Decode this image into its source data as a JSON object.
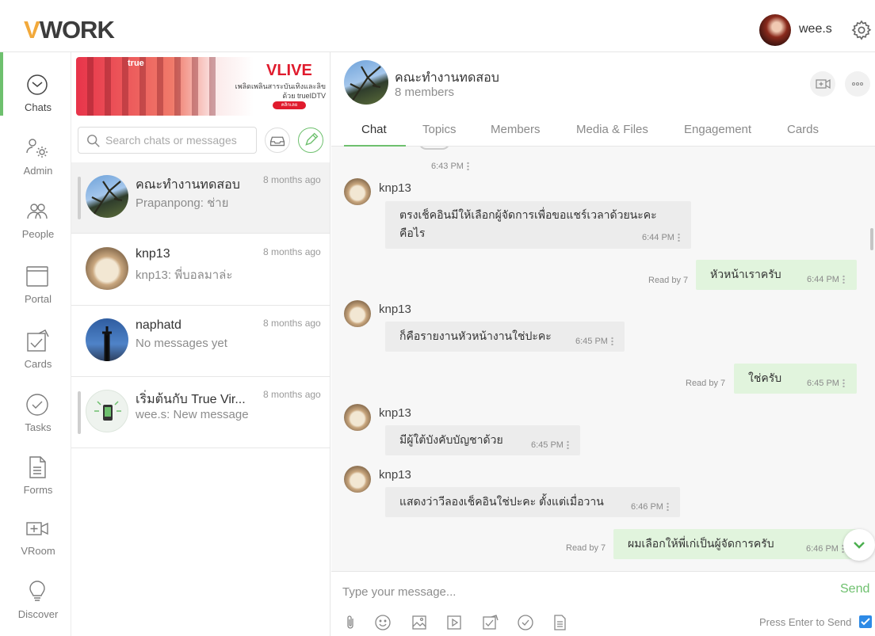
{
  "app": {
    "logo_prefix": "V",
    "logo_rest": "WORK",
    "user_name": "wee.s"
  },
  "nav": {
    "items": [
      {
        "label": "Chats",
        "icon": "clock-icon"
      },
      {
        "label": "Admin",
        "icon": "admin-gear-people-icon"
      },
      {
        "label": "People",
        "icon": "people-icon"
      },
      {
        "label": "Portal",
        "icon": "window-icon"
      },
      {
        "label": "Cards",
        "icon": "cards-icon"
      },
      {
        "label": "Tasks",
        "icon": "check-circle-icon"
      },
      {
        "label": "Forms",
        "icon": "document-icon"
      },
      {
        "label": "VRoom",
        "icon": "video-plus-icon"
      },
      {
        "label": "Discover",
        "icon": "lightbulb-icon"
      }
    ],
    "active": "Chats",
    "accent": "#6ec06e"
  },
  "banner": {
    "brand": "true",
    "title": "VLIVE",
    "line1": "เพลิดเพลินสาระบันเทิงและลิข",
    "line2": "ด้วย trueIDTV",
    "button": "คลิกเลย"
  },
  "search": {
    "placeholder": "Search chats or messages"
  },
  "chats": [
    {
      "name": "คณะทำงานทดสอบ",
      "preview": "Prapanpong: ช่าย",
      "time": "8 months ago",
      "selected": true
    },
    {
      "name": "knp13",
      "preview": "knp13: พี่บอลมาล่ะ",
      "time": "8 months ago",
      "selected": false
    },
    {
      "name": "naphatd",
      "preview": "No messages yet",
      "time": "8 months ago",
      "selected": false
    },
    {
      "name": "เริ่มต้นกับ True Vir...",
      "preview": "wee.s: New message",
      "time": "8 months ago",
      "selected": false
    }
  ],
  "conversation": {
    "name": "คณะทำงานทดสอบ",
    "members": "8 members",
    "tabs": [
      "Chat",
      "Topics",
      "Members",
      "Media & Files",
      "Engagement",
      "Cards"
    ],
    "active_tab": "Chat",
    "top_time": "6:43 PM",
    "messages": [
      {
        "sender": "knp13",
        "text": [
          "ตรงเช็คอินมีให้เลือกผู้จัดการเพื่อขอแชร์เวลาด้วยนะคะ",
          "คือไร"
        ],
        "time": "6:44 PM",
        "mine": false
      },
      {
        "sender": "wee.s",
        "text": [
          "หัวหน้าเราครับ"
        ],
        "time": "6:44 PM",
        "mine": true,
        "read": "Read by 7"
      },
      {
        "sender": "knp13",
        "text": [
          "ก็คือรายงานหัวหน้างานใช่ปะคะ"
        ],
        "time": "6:45 PM",
        "mine": false
      },
      {
        "sender": "wee.s",
        "text": [
          "ใช่ครับ"
        ],
        "time": "6:45 PM",
        "mine": true,
        "read": "Read by 7"
      },
      {
        "sender": "knp13",
        "text": [
          "มีผู้ใต้บังคับบัญชาด้วย"
        ],
        "time": "6:45 PM",
        "mine": false
      },
      {
        "sender": "knp13",
        "text": [
          "แสดงว่าวีลองเช็คอินใช่ปะคะ ตั้งแต่เมื่อวาน"
        ],
        "time": "6:46 PM",
        "mine": false
      },
      {
        "sender": "wee.s",
        "text": [
          "ผมเลือกให้พี่เก่เป็นผู้จัดการครับ"
        ],
        "time": "6:46 PM",
        "mine": true,
        "read": "Read by 7"
      }
    ]
  },
  "composer": {
    "placeholder": "Type your message...",
    "send_label": "Send",
    "enter_label": "Press Enter to Send",
    "enter_checked": true,
    "tools": [
      "paperclip-icon",
      "emoji-icon",
      "image-icon",
      "video-icon",
      "card-icon",
      "task-icon",
      "form-icon"
    ]
  }
}
